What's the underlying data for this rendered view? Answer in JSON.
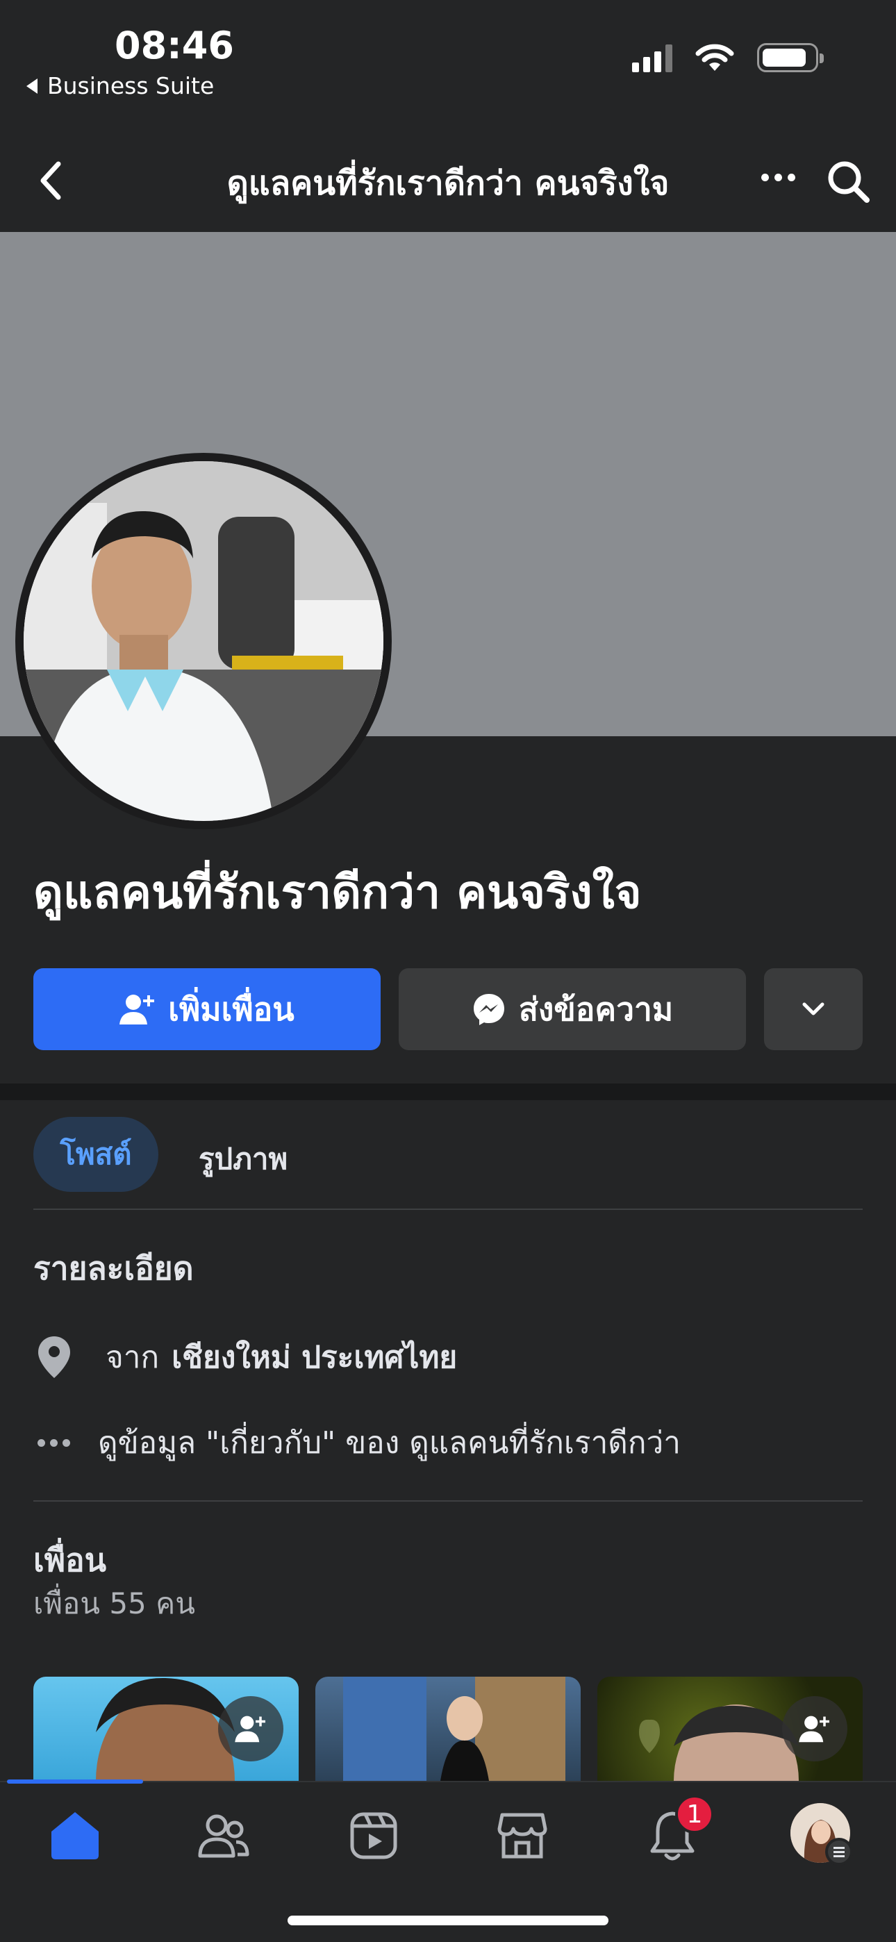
{
  "status_bar": {
    "time": "08:46",
    "back_app_label": "Business Suite"
  },
  "nav": {
    "title": "ดูแลคนที่รักเราดีกว่า คนจริงใจ"
  },
  "profile": {
    "name": "ดูแลคนที่รักเราดีกว่า คนจริงใจ"
  },
  "actions": {
    "add_friend_label": "เพิ่มเพื่อน",
    "message_label": "ส่งข้อความ"
  },
  "tabs": [
    {
      "label": "โพสต์",
      "active": true
    },
    {
      "label": "รูปภาพ",
      "active": false
    }
  ],
  "details": {
    "title": "รายละเอียด",
    "location_prefix": "จาก",
    "location_value": "เชียงใหม่ ประเทศไทย",
    "about_link": "ดูข้อมูล \"เกี่ยวกับ\" ของ ดูแลคนที่รักเราดีกว่า"
  },
  "friends": {
    "title": "เพื่อน",
    "count_text": "เพื่อน 55 คน"
  },
  "bottom_nav": {
    "items": [
      "home-icon",
      "friends-icon",
      "video-icon",
      "marketplace-icon",
      "bell-icon",
      "profile-avatar"
    ],
    "notification_count": "1"
  },
  "colors": {
    "accent": "#2d6cf5",
    "background": "#242526",
    "badge": "#e41e3f"
  }
}
